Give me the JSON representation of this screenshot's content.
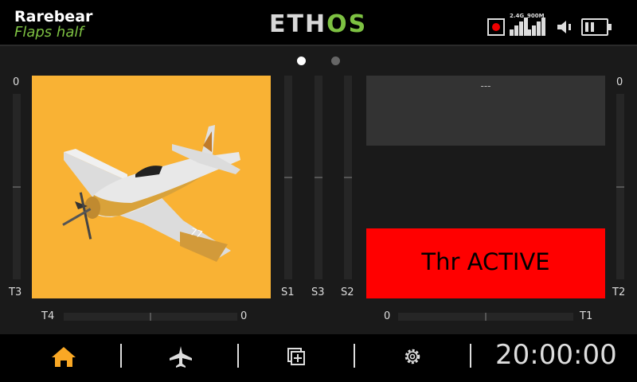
{
  "header": {
    "model_name": "Rarebear",
    "flight_mode": "Flaps half",
    "logo_part1": "ETH",
    "logo_part2": "OS",
    "signal1_label": "2.4G",
    "signal2_label": "900M"
  },
  "pages": {
    "active_index": 0,
    "count": 2
  },
  "trims": {
    "left_vertical_top_value": "0",
    "left_vertical_label": "T3",
    "right_vertical_top_value": "0",
    "right_vertical_label": "T2",
    "bottom_left_label": "T4",
    "bottom_left_value": "0",
    "bottom_right_label": "T1",
    "bottom_right_value": "0"
  },
  "sliders": {
    "s1": "S1",
    "s3": "S3",
    "s2": "S2"
  },
  "widgets": {
    "value_text": "---",
    "thr_text": "Thr ACTIVE",
    "thr_color": "#ff0000"
  },
  "navbar": {
    "items": [
      "home-icon",
      "airplane-icon",
      "widgets-icon",
      "gear-icon"
    ],
    "active_color": "#f9a825",
    "clock": "20:00:00"
  },
  "colors": {
    "accent_green": "#7dc142",
    "image_background": "#f9b234"
  }
}
